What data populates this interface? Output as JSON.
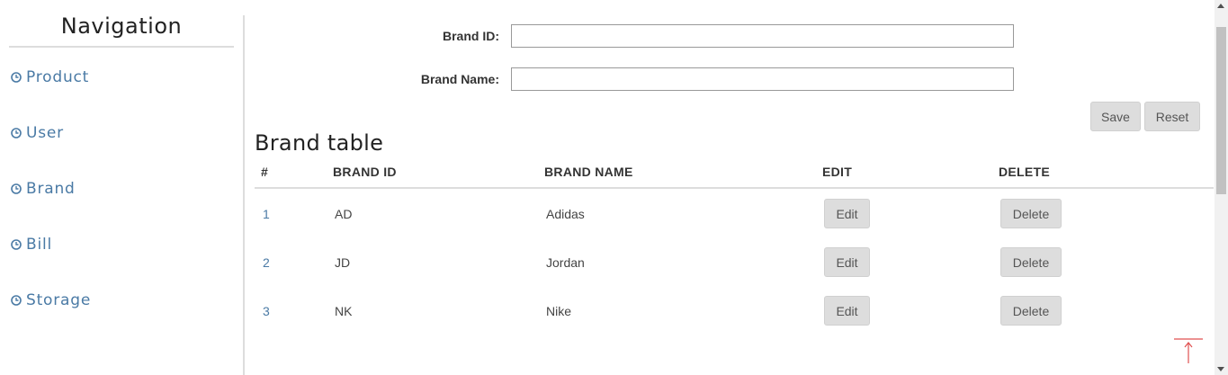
{
  "sidebar": {
    "title": "Navigation",
    "items": [
      {
        "label": "Product",
        "icon": "clock-icon"
      },
      {
        "label": "User",
        "icon": "clock-icon"
      },
      {
        "label": "Brand",
        "icon": "clock-icon"
      },
      {
        "label": "Bill",
        "icon": "clock-icon"
      },
      {
        "label": "Storage",
        "icon": "clock-icon"
      }
    ]
  },
  "form": {
    "brand_id_label": "Brand ID:",
    "brand_id_value": "",
    "brand_name_label": "Brand Name:",
    "brand_name_value": "",
    "save_label": "Save",
    "reset_label": "Reset"
  },
  "table": {
    "title": "Brand table",
    "headers": [
      "#",
      "BRAND ID",
      "BRAND NAME",
      "EDIT",
      "DELETE"
    ],
    "rows": [
      {
        "index": "1",
        "brand_id": "AD",
        "brand_name": "Adidas",
        "edit": "Edit",
        "delete": "Delete"
      },
      {
        "index": "2",
        "brand_id": "JD",
        "brand_name": "Jordan",
        "edit": "Edit",
        "delete": "Delete"
      },
      {
        "index": "3",
        "brand_id": "NK",
        "brand_name": "Nike",
        "edit": "Edit",
        "delete": "Delete"
      }
    ]
  },
  "colors": {
    "link": "#4a7aa5",
    "button_bg": "#dddddd",
    "back_to_top": "#e05050"
  },
  "back_to_top_icon": "arrow-up-icon"
}
